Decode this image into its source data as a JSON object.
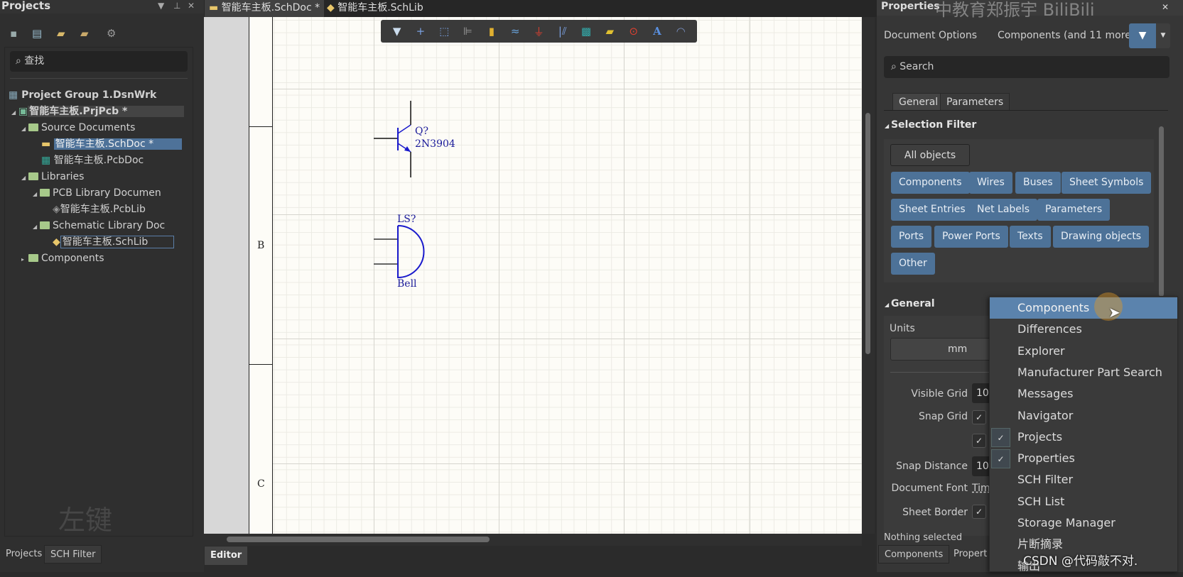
{
  "projects_panel": {
    "title": "Projects",
    "title_icons": [
      "dropdown-icon",
      "pin-icon",
      "close-icon"
    ],
    "search_placeholder": "查找",
    "tree": [
      {
        "label": "Project Group 1.DsnWrk",
        "icon": "project-group-icon"
      },
      {
        "label": "智能车主板.PrjPcb *",
        "icon": "pcb-project-icon"
      },
      {
        "label": "Source Documents",
        "icon": "folder-icon"
      },
      {
        "label": "智能车主板.SchDoc *",
        "icon": "schdoc-icon",
        "selected": true
      },
      {
        "label": "智能车主板.PcbDoc",
        "icon": "pcbdoc-icon"
      },
      {
        "label": "Libraries",
        "icon": "folder-icon"
      },
      {
        "label": "PCB Library Documen",
        "icon": "folder-icon"
      },
      {
        "label": "智能车主板.PcbLib",
        "icon": "pcblib-icon"
      },
      {
        "label": "Schematic Library Doc",
        "icon": "folder-icon"
      },
      {
        "label": "智能车主板.SchLib",
        "icon": "schlib-icon"
      },
      {
        "label": "Components",
        "icon": "folder-icon"
      }
    ],
    "watermark": "左键",
    "bottom_tabs": [
      "Projects",
      "SCH Filter"
    ]
  },
  "doc_tabs": [
    {
      "label": "智能车主板.SchDoc *",
      "active": true
    },
    {
      "label": "智能车主板.SchLib"
    }
  ],
  "toolbar_icons": [
    "filter-icon",
    "cross-icon",
    "select-rect-icon",
    "align-icon",
    "part-icon",
    "wire-icon",
    "ground-icon",
    "bus-icon",
    "sheet-symbol-icon",
    "net-label-icon",
    "port-icon",
    "text-icon",
    "arc-icon"
  ],
  "schematic": {
    "zones": [
      "B",
      "C"
    ],
    "transistor": {
      "designator": "Q?",
      "comment": "2N3904"
    },
    "bell": {
      "designator": "LS?",
      "comment": "Bell"
    }
  },
  "editor_tab": "Editor",
  "properties": {
    "title": "Properties",
    "watermark": "中教育郑振宇 BiliBili",
    "doc_options": "Document Options",
    "filter_summary": "Components (and 11 more)",
    "search_placeholder": "Search",
    "tabs": [
      "General",
      "Parameters"
    ],
    "selection_filter": {
      "title": "Selection Filter",
      "all": "All objects",
      "buttons": [
        "Components",
        "Wires",
        "Buses",
        "Sheet Symbols",
        "Sheet Entries",
        "Net Labels",
        "Parameters",
        "Ports",
        "Power Ports",
        "Texts",
        "Drawing objects",
        "Other"
      ]
    },
    "general": {
      "title": "General",
      "units_label": "Units",
      "units_value": "mm",
      "visible_grid_label": "Visible Grid",
      "visible_grid_value": "10",
      "snap_grid_label": "Snap Grid",
      "snap_distance_label": "Snap Distance",
      "snap_distance_value": "10",
      "document_font_label": "Document Font",
      "document_font_value": "Tim",
      "sheet_border_label": "Sheet Border"
    },
    "status": "Nothing selected",
    "bottom_tabs": [
      "Components",
      "Propert"
    ]
  },
  "panels_menu": {
    "items": [
      {
        "label": "Components",
        "highlighted": true
      },
      {
        "label": "Differences"
      },
      {
        "label": "Explorer"
      },
      {
        "label": "Manufacturer Part Search"
      },
      {
        "label": "Messages"
      },
      {
        "label": "Navigator"
      },
      {
        "label": "Projects",
        "checked": true
      },
      {
        "label": "Properties",
        "checked": true
      },
      {
        "label": "SCH Filter"
      },
      {
        "label": "SCH List"
      },
      {
        "label": "Storage Manager"
      },
      {
        "label": "片断摘录"
      },
      {
        "label": "输出"
      }
    ]
  },
  "csdn_watermark": "CSDN @代码敲不对.",
  "colors": {
    "accent": "#4d7298",
    "menu_highlight": "#5b83ad",
    "schematic_blue": "#1a1a9a"
  }
}
